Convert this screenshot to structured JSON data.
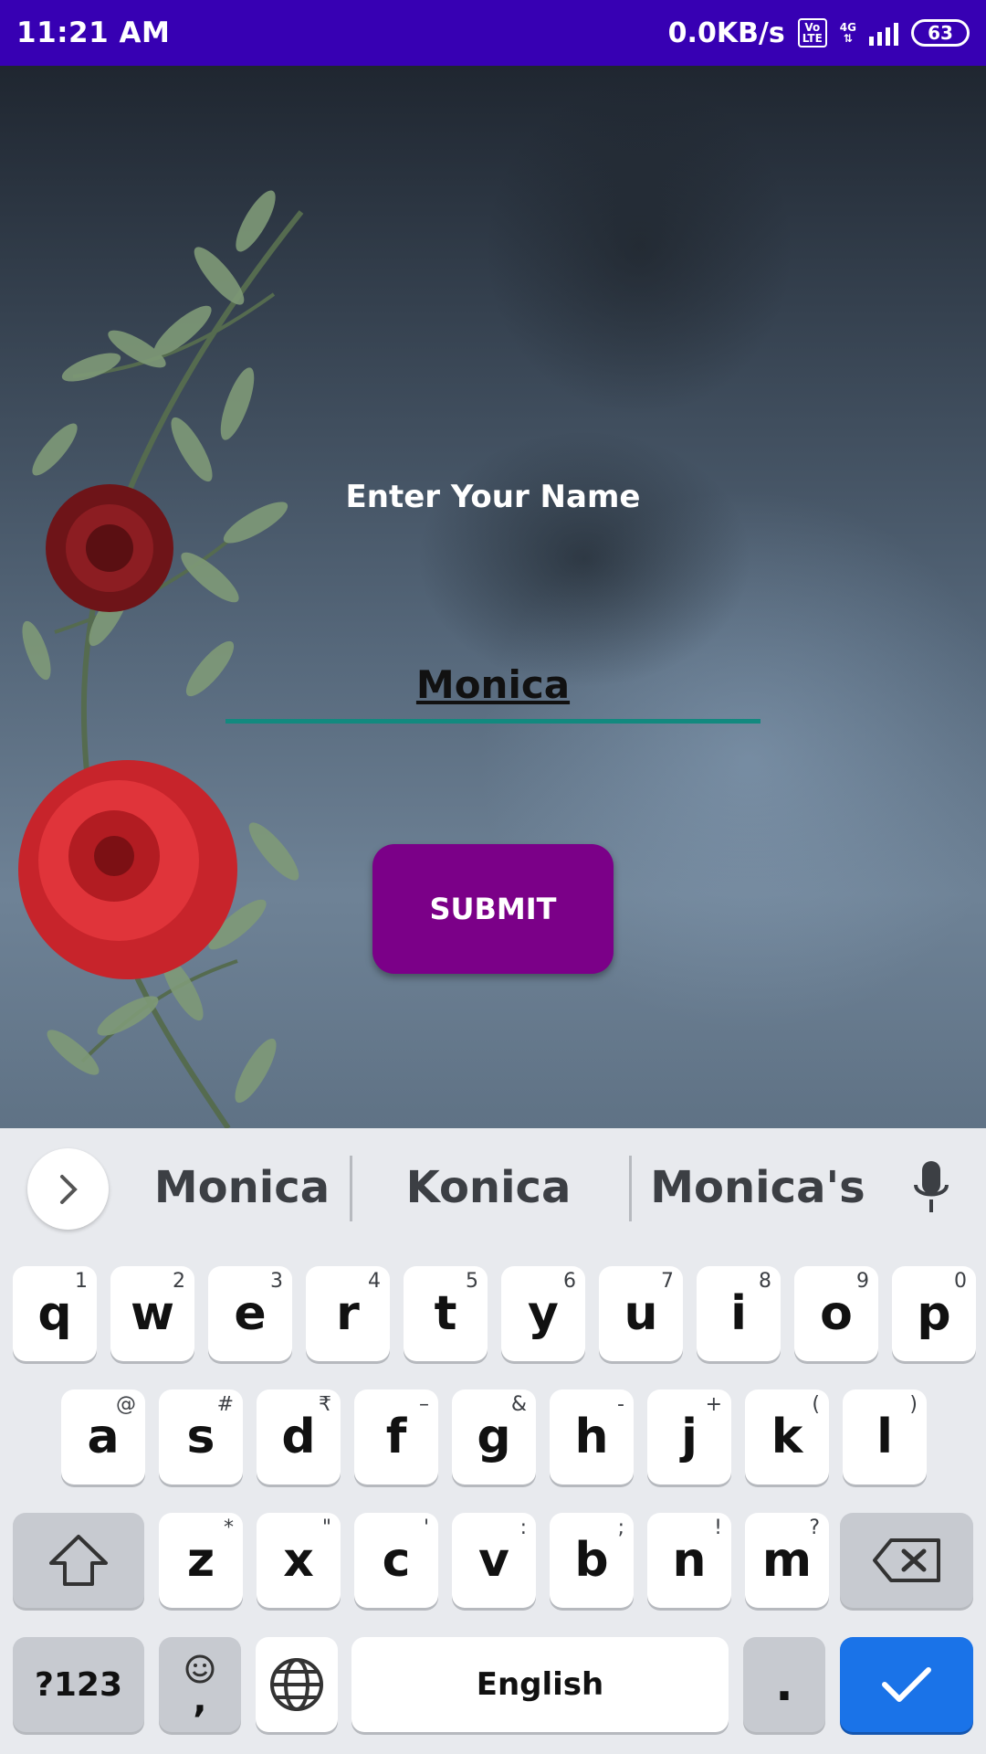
{
  "status_bar": {
    "time": "11:21 AM",
    "speed": "0.0KB/s",
    "volte_top": "Vo",
    "volte_bottom": "LTE",
    "network": "4G",
    "battery": "63"
  },
  "app": {
    "prompt": "Enter Your Name",
    "name_value": "Monica",
    "submit_label": "SUBMIT",
    "colors": {
      "status_bar": "#3700b3",
      "submit": "#7b0088",
      "input_underline": "#13897f"
    }
  },
  "keyboard": {
    "suggestions": [
      "Monica",
      "Konica",
      "Monica's"
    ],
    "row1": [
      {
        "k": "q",
        "h": "1"
      },
      {
        "k": "w",
        "h": "2"
      },
      {
        "k": "e",
        "h": "3"
      },
      {
        "k": "r",
        "h": "4"
      },
      {
        "k": "t",
        "h": "5"
      },
      {
        "k": "y",
        "h": "6"
      },
      {
        "k": "u",
        "h": "7"
      },
      {
        "k": "i",
        "h": "8"
      },
      {
        "k": "o",
        "h": "9"
      },
      {
        "k": "p",
        "h": "0"
      }
    ],
    "row2": [
      {
        "k": "a",
        "h": "@"
      },
      {
        "k": "s",
        "h": "#"
      },
      {
        "k": "d",
        "h": "₹"
      },
      {
        "k": "f",
        "h": "–"
      },
      {
        "k": "g",
        "h": "&"
      },
      {
        "k": "h",
        "h": "-"
      },
      {
        "k": "j",
        "h": "+"
      },
      {
        "k": "k",
        "h": "("
      },
      {
        "k": "l",
        "h": ")"
      }
    ],
    "row3": [
      {
        "k": "z",
        "h": "*"
      },
      {
        "k": "x",
        "h": "\""
      },
      {
        "k": "c",
        "h": "'"
      },
      {
        "k": "v",
        "h": ":"
      },
      {
        "k": "b",
        "h": ";"
      },
      {
        "k": "n",
        "h": "!"
      },
      {
        "k": "m",
        "h": "?"
      }
    ],
    "symbols_label": "?123",
    "comma_label": ",",
    "space_label": "English",
    "period_label": ".",
    "icons": [
      "chevron-right-icon",
      "mic-icon",
      "shift-icon",
      "backspace-icon",
      "emoji-icon",
      "globe-icon",
      "check-icon"
    ]
  }
}
